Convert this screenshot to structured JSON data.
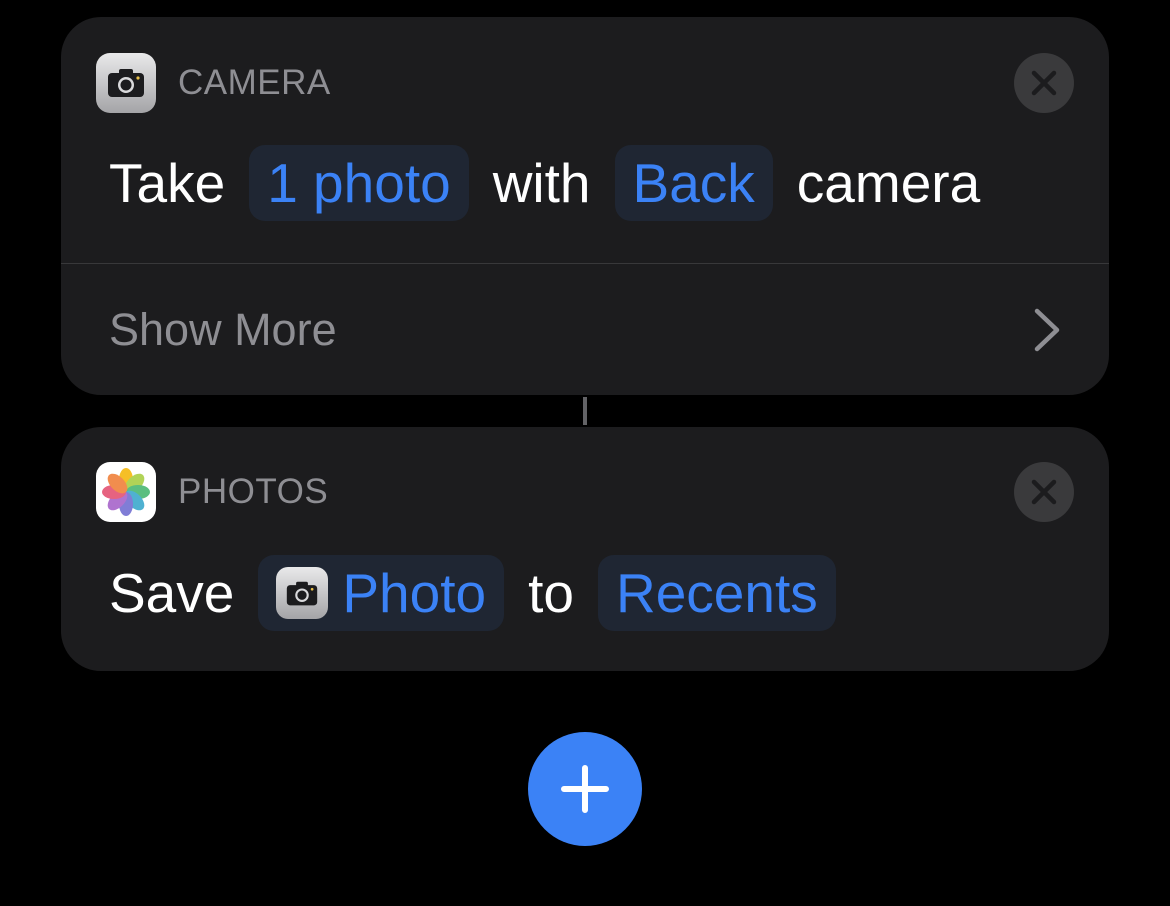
{
  "actions": [
    {
      "app_name": "CAMERA",
      "icon": "camera-icon",
      "sentence": {
        "word1": "Take",
        "token1": "1 photo",
        "word2": "with",
        "token2": "Back",
        "word3": "camera"
      },
      "show_more_label": "Show More"
    },
    {
      "app_name": "PHOTOS",
      "icon": "photos-icon",
      "sentence": {
        "word1": "Save",
        "token1": "Photo",
        "word2": "to",
        "token2": "Recents"
      }
    }
  ],
  "colors": {
    "background": "#000000",
    "card": "#1c1c1e",
    "accent": "#3b82f6",
    "token_bg": "#1f2633",
    "secondary_text": "#8e8e93",
    "close_bg": "#3a3a3c"
  },
  "icons": {
    "close": "close-icon",
    "chevron": "chevron-right-icon",
    "add": "plus-icon"
  }
}
